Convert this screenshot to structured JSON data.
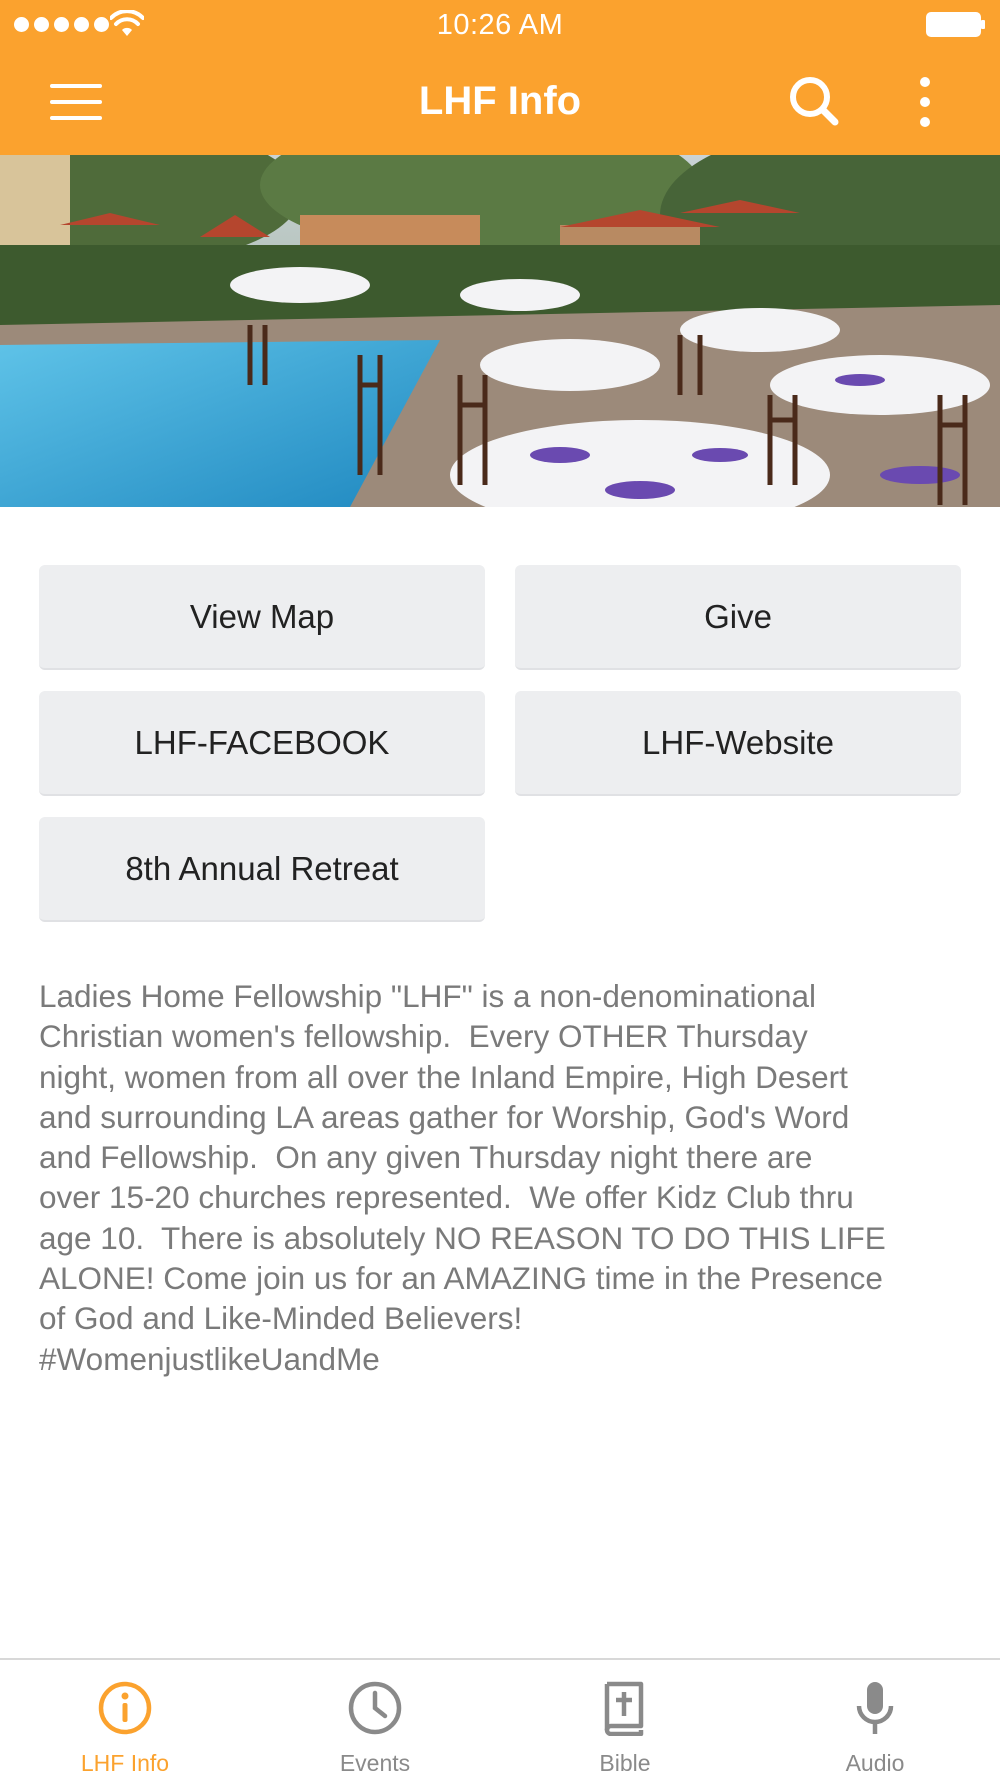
{
  "status_bar": {
    "time": "10:26 AM",
    "signal_icon": "signal-dots-icon",
    "wifi_icon": "wifi-icon",
    "battery_icon": "battery-icon"
  },
  "header": {
    "title": "LHF Info",
    "background_color": "#FBA22E",
    "menu_icon": "hamburger-menu-icon",
    "search_icon": "search-icon",
    "more_icon": "more-vertical-icon"
  },
  "hero": {
    "image_icon": "poolside-banquet-photo"
  },
  "buttons": {
    "view_map": "View Map",
    "give": "Give",
    "facebook": "LHF-FACEBOOK",
    "website": "LHF-Website",
    "retreat": "8th Annual Retreat"
  },
  "description": "Ladies Home Fellowship \"LHF\" is a non-denominational\nChristian women's fellowship.  Every OTHER Thursday\nnight, women from all over the Inland Empire, High Desert\nand surrounding LA areas gather for Worship, God's Word\nand Fellowship.  On any given Thursday night there are\nover 15-20 churches represented.  We offer Kidz Club thru\nage 10.  There is absolutely NO REASON TO DO THIS LIFE\nALONE! Come join us for an AMAZING time in the Presence\nof God and Like-Minded Believers!\n#WomenjustlikeUandMe",
  "tabs": [
    {
      "label": "LHF Info",
      "icon": "info-icon",
      "active": true
    },
    {
      "label": "Events",
      "icon": "clock-icon",
      "active": false
    },
    {
      "label": "Bible",
      "icon": "bible-icon",
      "active": false
    },
    {
      "label": "Audio",
      "icon": "microphone-icon",
      "active": false
    }
  ],
  "colors": {
    "accent": "#FBA22E",
    "button_bg": "#EDEEF0",
    "text_gray": "#7A7A7A",
    "tab_inactive": "#8A8A8A"
  }
}
